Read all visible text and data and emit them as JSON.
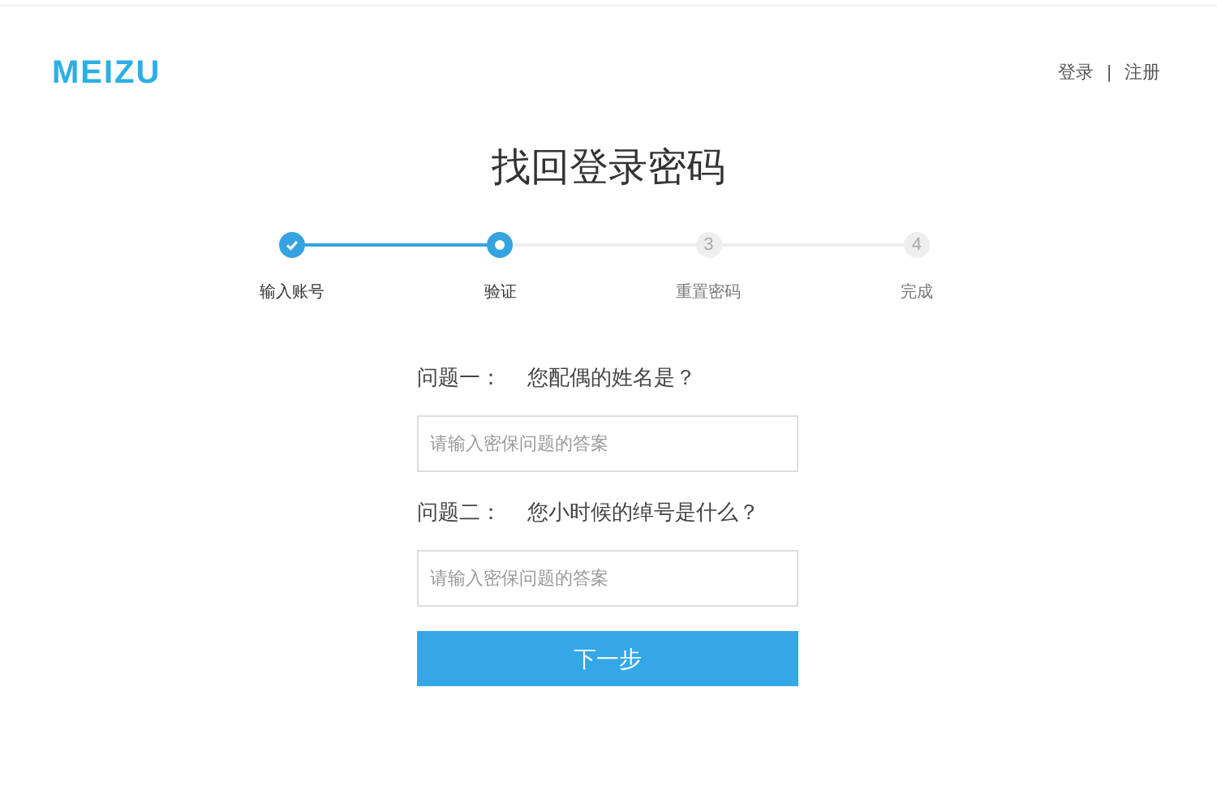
{
  "header": {
    "logo": "MEIZU",
    "links": [
      {
        "label": "登录"
      },
      {
        "label": "注册"
      }
    ],
    "separator": "|"
  },
  "title": "找回登录密码",
  "steps": [
    {
      "label": "输入账号",
      "kind": "done"
    },
    {
      "label": "验证",
      "kind": "current"
    },
    {
      "number": "3",
      "label": "重置密码",
      "kind": "pending"
    },
    {
      "number": "4",
      "label": "完成",
      "kind": "pending"
    }
  ],
  "questions": [
    {
      "label": "问题一：",
      "question": "您配偶的姓名是？",
      "placeholder": "请输入密保问题的答案"
    },
    {
      "label": "问题二：",
      "question": "您小时候的绰号是什么？",
      "placeholder": "请输入密保问题的答案"
    }
  ],
  "submit": "下一步"
}
